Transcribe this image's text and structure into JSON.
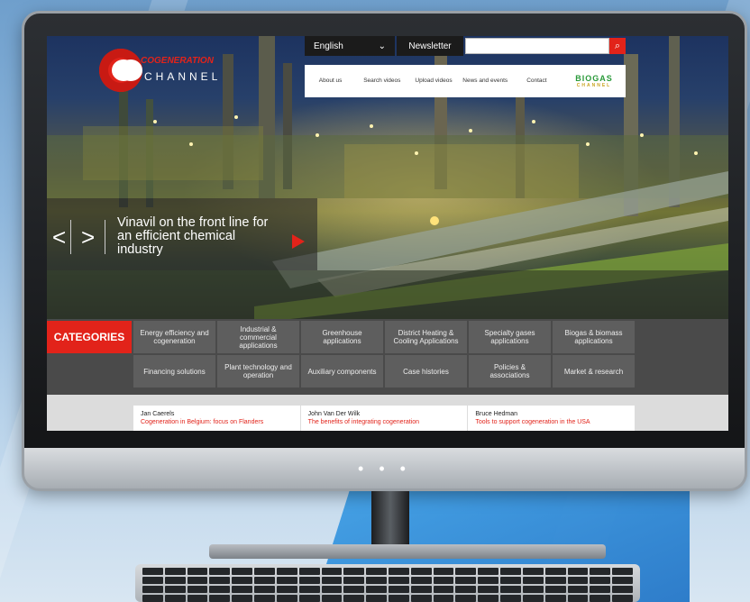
{
  "site": {
    "logo": {
      "top": "COGENERATION",
      "bottom": "CHANNEL"
    },
    "topbar": {
      "language": "English",
      "newsletter": "Newsletter",
      "search_placeholder": ""
    },
    "nav": [
      {
        "label": "About us"
      },
      {
        "label": "Search videos"
      },
      {
        "label": "Upload videos"
      },
      {
        "label": "News and events"
      },
      {
        "label": "Contact"
      }
    ],
    "partner_logo": {
      "name": "BIOGAS",
      "sub": "CHANNEL"
    },
    "slider": {
      "caption": "Vinavil on the front line for an efficient chemical industry",
      "prev": "<",
      "next": ">"
    },
    "categories": {
      "label": "CATEGORIES",
      "items": [
        "Energy efficiency and cogeneration",
        "Industrial & commercial applications",
        "Greenhouse applications",
        "District Heating & Cooling Applications",
        "Specialty gases applications",
        "Biogas & biomass applications",
        "Financing solutions",
        "Plant technology and operation",
        "Auxiliary components",
        "Case histories",
        "Policies & associations",
        "Market & research"
      ]
    },
    "news": [
      {
        "author": "Jan Caerels",
        "title": "Cogeneration in Belgium: focus on Flanders"
      },
      {
        "author": "John Van Der Wilk",
        "title": "The benefits of integrating cogeneration"
      },
      {
        "author": "Bruce Hedman",
        "title": "Tools to support cogeneration in the USA"
      }
    ]
  },
  "device": {
    "chin_dots": "• • •"
  }
}
